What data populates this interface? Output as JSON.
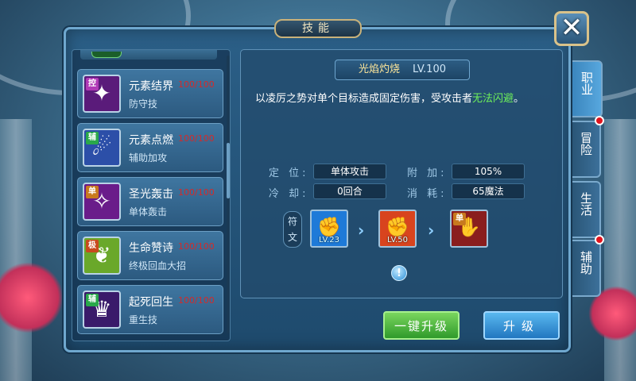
{
  "window": {
    "title": "技能",
    "close_icon": "close-icon"
  },
  "skills": [
    {
      "name": "元素结界",
      "level": "100/100",
      "desc": "防守技",
      "badge": "控",
      "badge_color": "#b03ab6",
      "icon": "✦",
      "icon_bg": "#5a1b7a"
    },
    {
      "name": "元素点燃",
      "level": "100/100",
      "desc": "辅助加攻",
      "badge": "辅",
      "badge_color": "#2aa84a",
      "icon": "☄",
      "icon_bg": "#2c4fa8"
    },
    {
      "name": "圣光轰击",
      "level": "100/100",
      "desc": "单体轰击",
      "badge": "单",
      "badge_color": "#c87a1e",
      "icon": "✧",
      "icon_bg": "#6a1c8a"
    },
    {
      "name": "生命赞诗",
      "level": "100/100",
      "desc": "终极回血大招",
      "badge": "极",
      "badge_color": "#c84a1e",
      "icon": "❦",
      "icon_bg": "#6aa82a"
    },
    {
      "name": "起死回生",
      "level": "100/100",
      "desc": "重生技",
      "badge": "辅",
      "badge_color": "#2aa84a",
      "icon": "♛",
      "icon_bg": "#3a1a6a"
    }
  ],
  "detail": {
    "skill_name": "光焰灼烧",
    "level": "LV.100",
    "desc_prefix": "以凌厉之势对单个目标造成固定伤害，受攻击者",
    "desc_highlight": "无法闪避",
    "desc_suffix": "。",
    "stats": {
      "position_label": "定 位:",
      "position_value": "单体攻击",
      "cooldown_label": "冷 却:",
      "cooldown_value": "0回合",
      "bonus_label": "附 加:",
      "bonus_value": "105%",
      "cost_label": "消 耗:",
      "cost_value": "65魔法"
    },
    "rune_label": "符文",
    "runes": [
      {
        "level": "LV.23",
        "icon": "✊",
        "bg": "#1e7ad8"
      },
      {
        "level": "LV.50",
        "icon": "✊",
        "bg": "#d8441e"
      },
      {
        "level": "",
        "icon": "✋",
        "bg": "#8a1e1e",
        "badge": "单"
      }
    ]
  },
  "buttons": {
    "one_click_upgrade": "一键升级",
    "upgrade": "升级"
  },
  "tabs": [
    {
      "label": "职业",
      "active": true,
      "dot": false
    },
    {
      "label": "冒险",
      "active": false,
      "dot": true
    },
    {
      "label": "生活",
      "active": false,
      "dot": false
    },
    {
      "label": "辅助",
      "active": false,
      "dot": true
    }
  ],
  "colors": {
    "accent_green": "#6ef05a",
    "level_red": "#d42a2a",
    "title_gold": "#ffe79a"
  }
}
